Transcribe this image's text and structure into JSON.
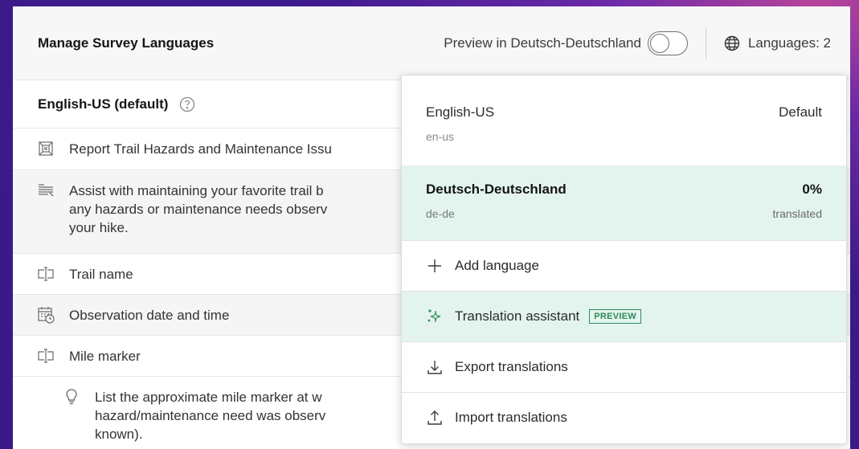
{
  "header": {
    "title": "Manage Survey Languages",
    "preview_label": "Preview in Deutsch-Deutschland",
    "preview_toggle_on": false,
    "languages_label": "Languages: 2"
  },
  "main": {
    "section_title": "English-US (default)",
    "rows": [
      {
        "icon": "form-title-icon",
        "text": "Report Trail Hazards and Maintenance Issu"
      },
      {
        "icon": "description-icon",
        "line1": "Assist with maintaining your favorite trail b",
        "line2": "any hazards or maintenance needs observ",
        "line3": "your hike."
      },
      {
        "icon": "text-field-icon",
        "text": "Trail name"
      },
      {
        "icon": "datetime-icon",
        "text": "Observation date and time"
      },
      {
        "icon": "text-field-icon",
        "text": "Mile marker"
      },
      {
        "icon": "hint-lightbulb-icon",
        "line1": "List the approximate mile marker at w",
        "line2": "hazard/maintenance need was observ",
        "line3": "known)."
      }
    ]
  },
  "dropdown": {
    "languages": [
      {
        "name": "English-US",
        "code": "en-us",
        "status": "Default"
      },
      {
        "name": "Deutsch-Deutschland",
        "code": "de-de",
        "percent": "0%",
        "status_sub": "translated"
      }
    ],
    "actions": {
      "add": "Add language",
      "assistant": "Translation assistant",
      "assistant_badge": "PREVIEW",
      "export": "Export translations",
      "import": "Import translations"
    }
  },
  "colors": {
    "accent_green": "#2e8b57",
    "highlight_bg": "#e3f4ee",
    "background_purple": "#3d1a8c"
  }
}
